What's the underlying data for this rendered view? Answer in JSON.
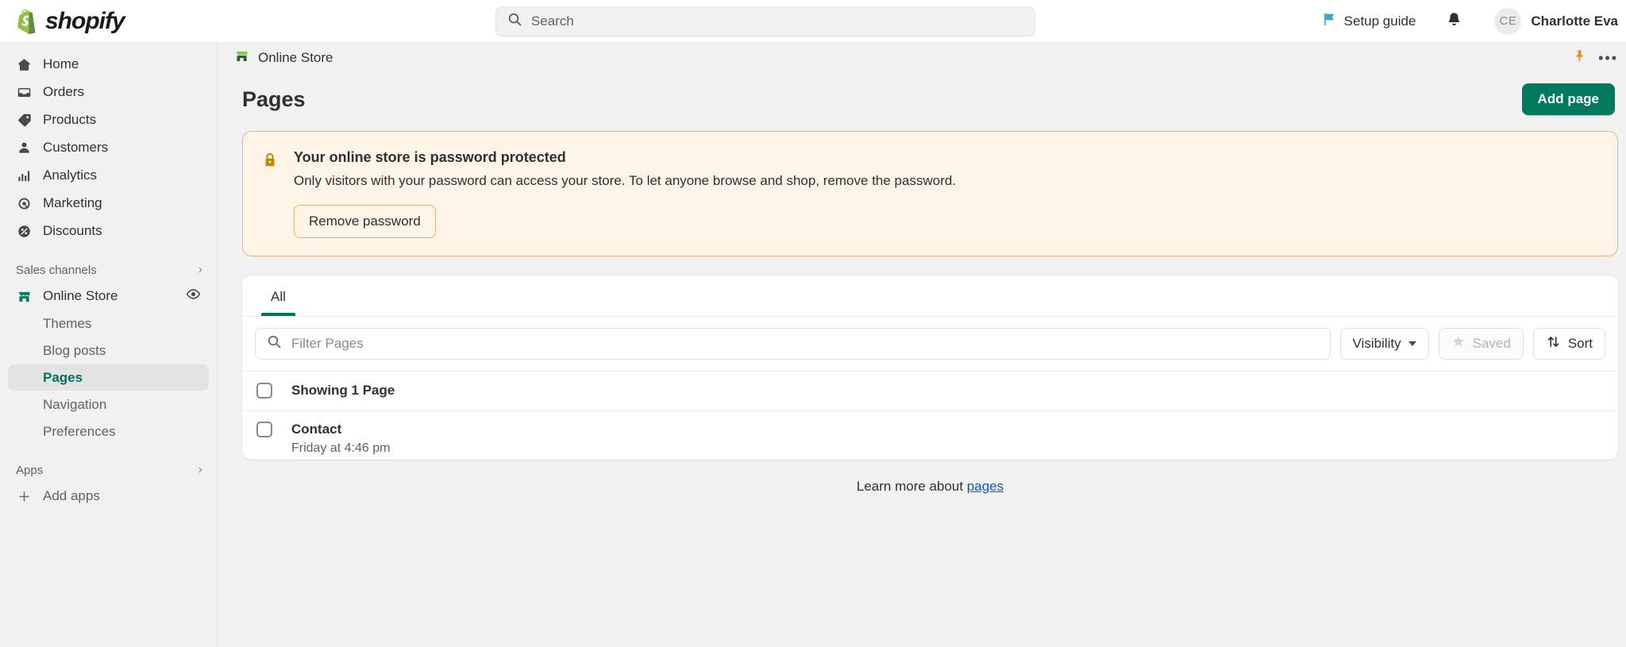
{
  "brand": {
    "name": "shopify",
    "accent": "#00795c",
    "link": "#005bd3"
  },
  "topbar": {
    "search": {
      "placeholder": "Search",
      "icon": "search-icon"
    },
    "setup_guide": {
      "label": "Setup guide",
      "icon": "flag-icon"
    },
    "notifications": {
      "icon": "bell-icon"
    },
    "user": {
      "initials": "CE",
      "name": "Charlotte Eva"
    }
  },
  "sidebar": {
    "items": [
      {
        "label": "Home",
        "icon": "home-icon"
      },
      {
        "label": "Orders",
        "icon": "orders-icon"
      },
      {
        "label": "Products",
        "icon": "tag-icon"
      },
      {
        "label": "Customers",
        "icon": "person-icon"
      },
      {
        "label": "Analytics",
        "icon": "bar-chart-icon"
      },
      {
        "label": "Marketing",
        "icon": "megaphone-icon"
      },
      {
        "label": "Discounts",
        "icon": "discount-icon"
      }
    ],
    "sales_channels": {
      "title": "Sales channels",
      "chevron": "chevron-right-icon"
    },
    "online_store": {
      "label": "Online Store",
      "icon": "storefront-icon",
      "view_icon": "eye-icon"
    },
    "sub_items": [
      {
        "label": "Themes",
        "active": false
      },
      {
        "label": "Blog posts",
        "active": false
      },
      {
        "label": "Pages",
        "active": true
      },
      {
        "label": "Navigation",
        "active": false
      },
      {
        "label": "Preferences",
        "active": false
      }
    ],
    "apps": {
      "title": "Apps",
      "chevron": "chevron-right-icon"
    },
    "add_apps": {
      "label": "Add apps",
      "icon": "plus-icon"
    }
  },
  "breadcrumb": {
    "label": "Online Store",
    "icon": "storefront-icon",
    "pin_icon": "pin-icon",
    "more_icon": "more-dots-icon"
  },
  "page": {
    "title": "Pages",
    "add_button": "Add page"
  },
  "banner": {
    "icon": "lock-icon",
    "title": "Your online store is password protected",
    "text": "Only visitors with your password can access your store. To let anyone browse and shop, remove the password.",
    "button": "Remove password",
    "background": "#fdf3e7",
    "border": "#e6b781"
  },
  "list_card": {
    "tabs": [
      {
        "label": "All",
        "active": true
      }
    ],
    "filter": {
      "placeholder": "Filter Pages",
      "icon": "search-icon"
    },
    "controls": [
      {
        "label": "Visibility",
        "icon": "chevron-down-icon",
        "disabled": false
      },
      {
        "label": "Saved",
        "icon": "star-icon",
        "disabled": true
      },
      {
        "label": "Sort",
        "icon": "sort-arrows-icon",
        "disabled": false
      }
    ],
    "summary_row": {
      "label": "Showing 1 Page",
      "checkbox": "select-all-checkbox"
    },
    "rows": [
      {
        "title": "Contact",
        "subtitle": "Friday at 4:46 pm"
      }
    ]
  },
  "footer": {
    "prefix": "Learn more about ",
    "link": "pages"
  }
}
